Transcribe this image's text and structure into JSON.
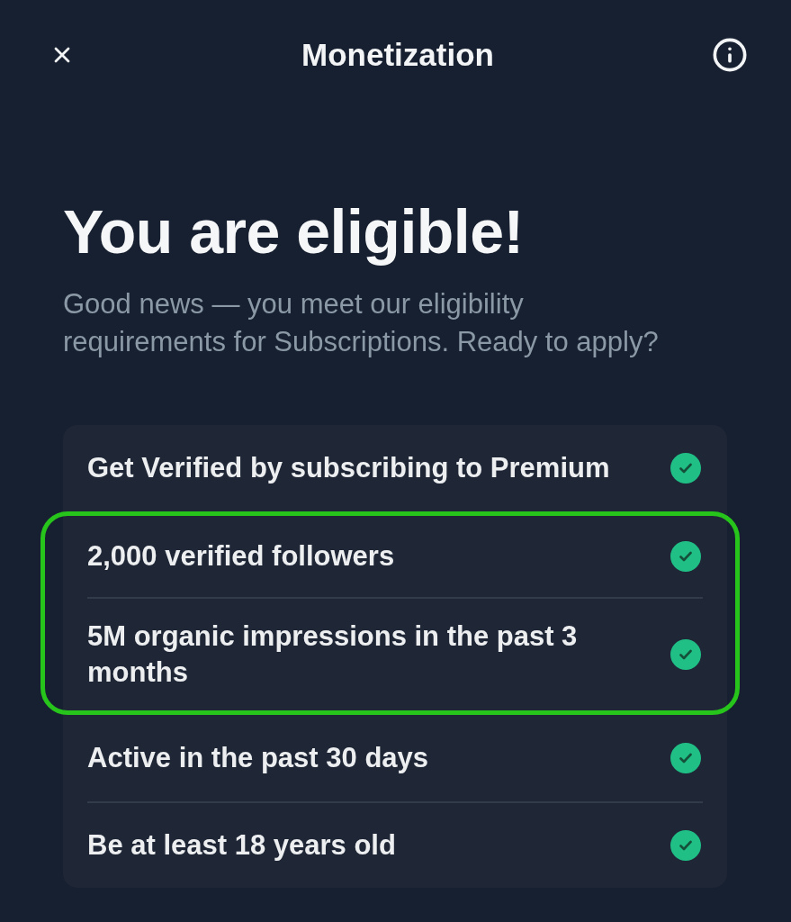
{
  "header": {
    "title": "Monetization"
  },
  "hero": {
    "title": "You are eligible!",
    "subtitle": "Good news — you meet our eligibility requirements for Subscriptions. Ready to apply?"
  },
  "requirements": [
    {
      "text": "Get Verified by subscribing to Premium",
      "met": true,
      "highlighted": false
    },
    {
      "text": "2,000 verified followers",
      "met": true,
      "highlighted": true
    },
    {
      "text": "5M organic impressions in the past 3 months",
      "met": true,
      "highlighted": true
    },
    {
      "text": "Active in the past 30 days",
      "met": true,
      "highlighted": false
    },
    {
      "text": "Be at least 18 years old",
      "met": true,
      "highlighted": false
    }
  ]
}
